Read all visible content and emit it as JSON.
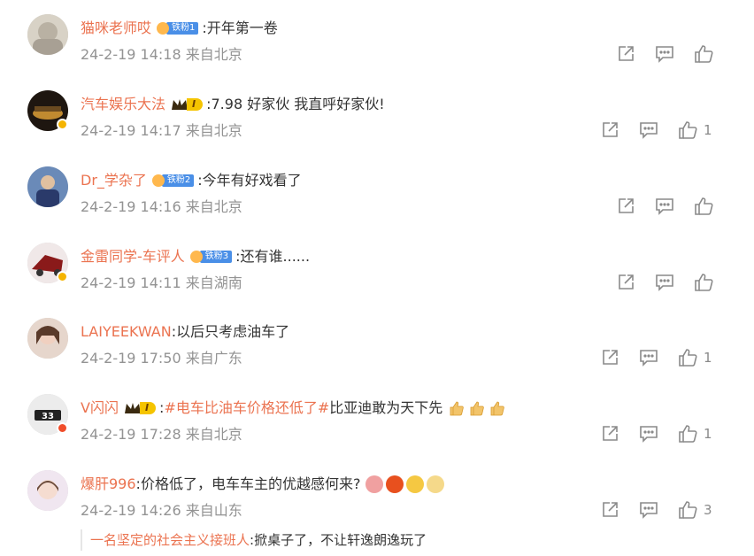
{
  "comments": [
    {
      "username": "猫咪老师哎",
      "badge": {
        "type": "fan",
        "label": "铁粉1"
      },
      "text": ":开年第一卷",
      "time": "24-2-19 14:18",
      "location": "来自北京",
      "likes": "",
      "verified": "none",
      "avatar_color": "#c9c3b8"
    },
    {
      "username": "汽车娱乐大法",
      "badge": {
        "type": "vip",
        "label": "I"
      },
      "text": ":7.98 好家伙 我直呼好家伙!",
      "time": "24-2-19 14:17",
      "location": "来自北京",
      "likes": "1",
      "verified": "yellow",
      "avatar_color": "#3a2a1a"
    },
    {
      "username": "Dr_学杂了",
      "badge": {
        "type": "fan",
        "label": "铁粉2"
      },
      "text": ":今年有好戏看了",
      "time": "24-2-19 14:16",
      "location": "来自北京",
      "likes": "",
      "verified": "none",
      "avatar_color": "#4a6a9a"
    },
    {
      "username": "金雷同学-车评人",
      "badge": {
        "type": "fan",
        "label": "铁粉3"
      },
      "text": ":还有谁......",
      "time": "24-2-19 14:11",
      "location": "来自湖南",
      "likes": "",
      "verified": "yellow",
      "avatar_color": "#8a2a2a"
    },
    {
      "username": "LAIYEEKWAN",
      "badge": {
        "type": "none",
        "label": ""
      },
      "text": ":以后只考虑油车了",
      "time": "24-2-19 17:50",
      "location": "来自广东",
      "likes": "1",
      "verified": "none",
      "avatar_color": "#d9b8a8"
    },
    {
      "username": "V闪闪",
      "badge": {
        "type": "vip",
        "label": "I"
      },
      "text": ":",
      "topic": "#电车比油车价格还低了#",
      "text_after": "比亚迪敢为天下先",
      "thumb_emojis": 3,
      "time": "24-2-19 17:28",
      "location": "来自北京",
      "likes": "1",
      "verified": "red",
      "avatar_color": "#e8e8e8"
    },
    {
      "username": "爆肝996",
      "badge": {
        "type": "none",
        "label": ""
      },
      "text": ":价格低了，电车车主的优越感何来?",
      "emoji_colors": [
        "#f0a0a0",
        "#e8501e",
        "#f5c842",
        "#f5d98a"
      ],
      "time": "24-2-19 14:26",
      "location": "来自山东",
      "likes": "3",
      "verified": "none",
      "avatar_color": "#e8d8e8"
    }
  ],
  "reply": {
    "username": "一名坚定的社会主义接班人",
    "text": ":掀桌子了，不让轩逸朗逸玩了"
  },
  "icons": [
    "share-icon",
    "comment-icon",
    "like-icon"
  ]
}
